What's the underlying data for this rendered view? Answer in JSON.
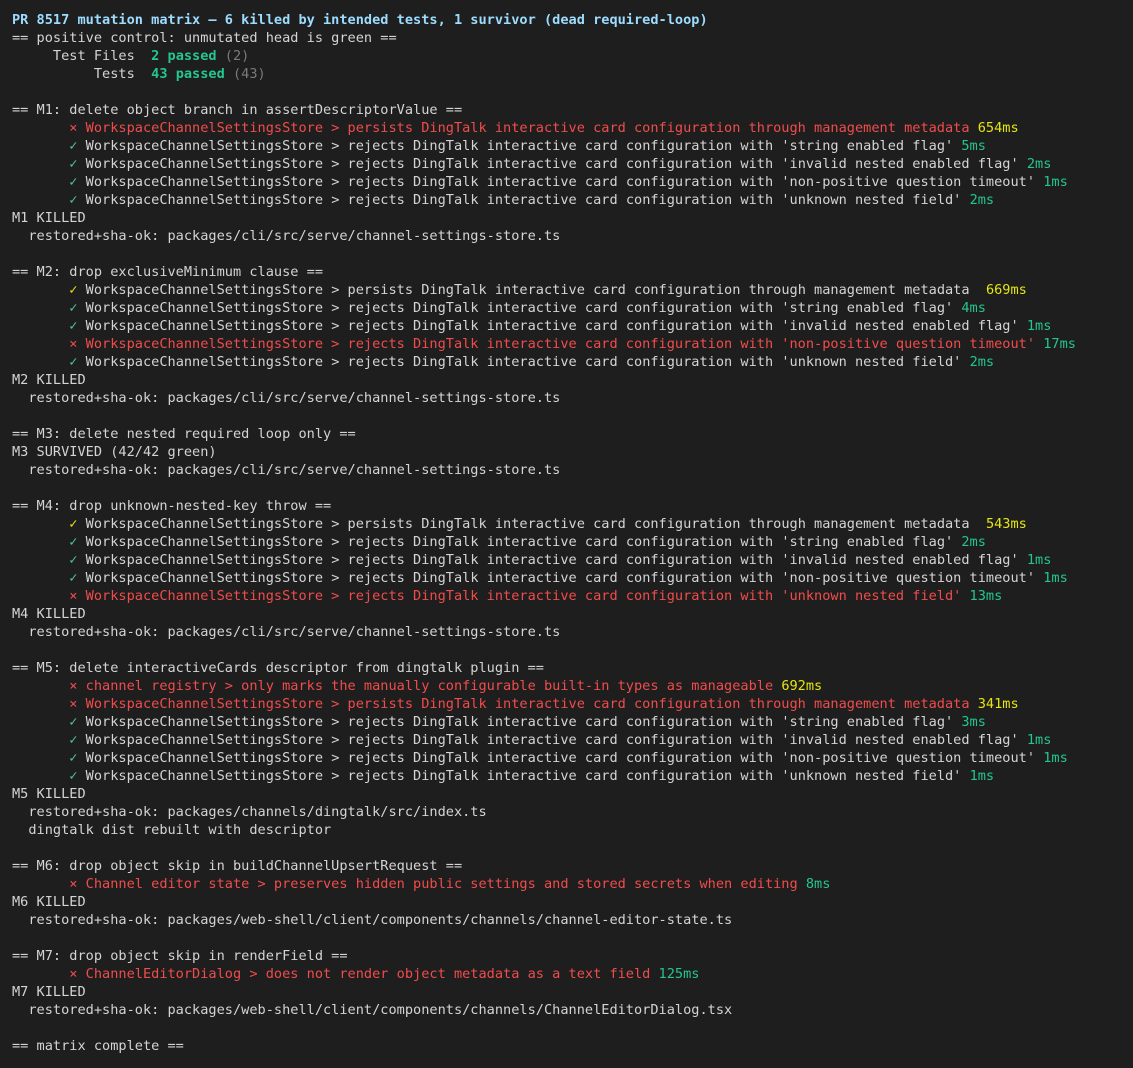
{
  "colors": {
    "background": "#1e1e1e",
    "text": "#d4d4d4",
    "header": "#9cdcfe",
    "pass_mark": "#4ec98f",
    "fail": "#f14c4c",
    "duration_slow": "#e5e510",
    "duration_fast": "#23c78e",
    "dim": "#7a7a7a"
  },
  "lines": [
    [
      {
        "t": "PR 8517 mutation matrix — 6 killed by intended tests, 1 survivor (dead required-loop)",
        "c": "header"
      }
    ],
    [
      {
        "t": "== positive control: unmutated head is green ==",
        "c": "plain"
      }
    ],
    [
      {
        "t": "     Test Files  ",
        "c": "plain"
      },
      {
        "t": "2 passed",
        "c": "bold-pass"
      },
      {
        "t": " (2)",
        "c": "dim"
      }
    ],
    [
      {
        "t": "          Tests  ",
        "c": "plain"
      },
      {
        "t": "43 passed",
        "c": "bold-pass"
      },
      {
        "t": " (43)",
        "c": "dim"
      }
    ],
    [],
    [
      {
        "t": "== M1: delete object branch in assertDescriptorValue ==",
        "c": "plain"
      }
    ],
    [
      {
        "t": "       × WorkspaceChannelSettingsStore > persists DingTalk interactive card configuration through management metadata ",
        "c": "fail"
      },
      {
        "t": "654ms",
        "c": "dur-slow"
      }
    ],
    [
      {
        "t": "       ✓",
        "c": "pass"
      },
      {
        "t": " WorkspaceChannelSettingsStore > rejects DingTalk interactive card configuration with 'string enabled flag' ",
        "c": "plain"
      },
      {
        "t": "5ms",
        "c": "dur-fast"
      }
    ],
    [
      {
        "t": "       ✓",
        "c": "pass"
      },
      {
        "t": " WorkspaceChannelSettingsStore > rejects DingTalk interactive card configuration with 'invalid nested enabled flag' ",
        "c": "plain"
      },
      {
        "t": "2ms",
        "c": "dur-fast"
      }
    ],
    [
      {
        "t": "       ✓",
        "c": "pass"
      },
      {
        "t": " WorkspaceChannelSettingsStore > rejects DingTalk interactive card configuration with 'non-positive question timeout' ",
        "c": "plain"
      },
      {
        "t": "1ms",
        "c": "dur-fast"
      }
    ],
    [
      {
        "t": "       ✓",
        "c": "pass"
      },
      {
        "t": " WorkspaceChannelSettingsStore > rejects DingTalk interactive card configuration with 'unknown nested field' ",
        "c": "plain"
      },
      {
        "t": "2ms",
        "c": "dur-fast"
      }
    ],
    [
      {
        "t": "M1 KILLED",
        "c": "plain"
      }
    ],
    [
      {
        "t": "  restored+sha-ok: packages/cli/src/serve/channel-settings-store.ts",
        "c": "plain"
      }
    ],
    [],
    [
      {
        "t": "== M2: drop exclusiveMinimum clause ==",
        "c": "plain"
      }
    ],
    [
      {
        "t": "       ✓",
        "c": "dur-slow"
      },
      {
        "t": " WorkspaceChannelSettingsStore > persists DingTalk interactive card configuration through management metadata  ",
        "c": "plain"
      },
      {
        "t": "669ms",
        "c": "dur-slow"
      }
    ],
    [
      {
        "t": "       ✓",
        "c": "pass"
      },
      {
        "t": " WorkspaceChannelSettingsStore > rejects DingTalk interactive card configuration with 'string enabled flag' ",
        "c": "plain"
      },
      {
        "t": "4ms",
        "c": "dur-fast"
      }
    ],
    [
      {
        "t": "       ✓",
        "c": "pass"
      },
      {
        "t": " WorkspaceChannelSettingsStore > rejects DingTalk interactive card configuration with 'invalid nested enabled flag' ",
        "c": "plain"
      },
      {
        "t": "1ms",
        "c": "dur-fast"
      }
    ],
    [
      {
        "t": "       × WorkspaceChannelSettingsStore > rejects DingTalk interactive card configuration with 'non-positive question timeout' ",
        "c": "fail"
      },
      {
        "t": "17ms",
        "c": "dur-fast"
      }
    ],
    [
      {
        "t": "       ✓",
        "c": "pass"
      },
      {
        "t": " WorkspaceChannelSettingsStore > rejects DingTalk interactive card configuration with 'unknown nested field' ",
        "c": "plain"
      },
      {
        "t": "2ms",
        "c": "dur-fast"
      }
    ],
    [
      {
        "t": "M2 KILLED",
        "c": "plain"
      }
    ],
    [
      {
        "t": "  restored+sha-ok: packages/cli/src/serve/channel-settings-store.ts",
        "c": "plain"
      }
    ],
    [],
    [
      {
        "t": "== M3: delete nested required loop only ==",
        "c": "plain"
      }
    ],
    [
      {
        "t": "M3 SURVIVED (42/42 green)",
        "c": "plain"
      }
    ],
    [
      {
        "t": "  restored+sha-ok: packages/cli/src/serve/channel-settings-store.ts",
        "c": "plain"
      }
    ],
    [],
    [
      {
        "t": "== M4: drop unknown-nested-key throw ==",
        "c": "plain"
      }
    ],
    [
      {
        "t": "       ✓",
        "c": "dur-slow"
      },
      {
        "t": " WorkspaceChannelSettingsStore > persists DingTalk interactive card configuration through management metadata  ",
        "c": "plain"
      },
      {
        "t": "543ms",
        "c": "dur-slow"
      }
    ],
    [
      {
        "t": "       ✓",
        "c": "pass"
      },
      {
        "t": " WorkspaceChannelSettingsStore > rejects DingTalk interactive card configuration with 'string enabled flag' ",
        "c": "plain"
      },
      {
        "t": "2ms",
        "c": "dur-fast"
      }
    ],
    [
      {
        "t": "       ✓",
        "c": "pass"
      },
      {
        "t": " WorkspaceChannelSettingsStore > rejects DingTalk interactive card configuration with 'invalid nested enabled flag' ",
        "c": "plain"
      },
      {
        "t": "1ms",
        "c": "dur-fast"
      }
    ],
    [
      {
        "t": "       ✓",
        "c": "pass"
      },
      {
        "t": " WorkspaceChannelSettingsStore > rejects DingTalk interactive card configuration with 'non-positive question timeout' ",
        "c": "plain"
      },
      {
        "t": "1ms",
        "c": "dur-fast"
      }
    ],
    [
      {
        "t": "       × WorkspaceChannelSettingsStore > rejects DingTalk interactive card configuration with 'unknown nested field' ",
        "c": "fail"
      },
      {
        "t": "13ms",
        "c": "dur-fast"
      }
    ],
    [
      {
        "t": "M4 KILLED",
        "c": "plain"
      }
    ],
    [
      {
        "t": "  restored+sha-ok: packages/cli/src/serve/channel-settings-store.ts",
        "c": "plain"
      }
    ],
    [],
    [
      {
        "t": "== M5: delete interactiveCards descriptor from dingtalk plugin ==",
        "c": "plain"
      }
    ],
    [
      {
        "t": "       × channel registry > only marks the manually configurable built-in types as manageable ",
        "c": "fail"
      },
      {
        "t": "692ms",
        "c": "dur-slow"
      }
    ],
    [
      {
        "t": "       × WorkspaceChannelSettingsStore > persists DingTalk interactive card configuration through management metadata ",
        "c": "fail"
      },
      {
        "t": "341ms",
        "c": "dur-slow"
      }
    ],
    [
      {
        "t": "       ✓",
        "c": "pass"
      },
      {
        "t": " WorkspaceChannelSettingsStore > rejects DingTalk interactive card configuration with 'string enabled flag' ",
        "c": "plain"
      },
      {
        "t": "3ms",
        "c": "dur-fast"
      }
    ],
    [
      {
        "t": "       ✓",
        "c": "pass"
      },
      {
        "t": " WorkspaceChannelSettingsStore > rejects DingTalk interactive card configuration with 'invalid nested enabled flag' ",
        "c": "plain"
      },
      {
        "t": "1ms",
        "c": "dur-fast"
      }
    ],
    [
      {
        "t": "       ✓",
        "c": "pass"
      },
      {
        "t": " WorkspaceChannelSettingsStore > rejects DingTalk interactive card configuration with 'non-positive question timeout' ",
        "c": "plain"
      },
      {
        "t": "1ms",
        "c": "dur-fast"
      }
    ],
    [
      {
        "t": "       ✓",
        "c": "pass"
      },
      {
        "t": " WorkspaceChannelSettingsStore > rejects DingTalk interactive card configuration with 'unknown nested field' ",
        "c": "plain"
      },
      {
        "t": "1ms",
        "c": "dur-fast"
      }
    ],
    [
      {
        "t": "M5 KILLED",
        "c": "plain"
      }
    ],
    [
      {
        "t": "  restored+sha-ok: packages/channels/dingtalk/src/index.ts",
        "c": "plain"
      }
    ],
    [
      {
        "t": "  dingtalk dist rebuilt with descriptor",
        "c": "plain"
      }
    ],
    [],
    [
      {
        "t": "== M6: drop object skip in buildChannelUpsertRequest ==",
        "c": "plain"
      }
    ],
    [
      {
        "t": "       × Channel editor state > preserves hidden public settings and stored secrets when editing ",
        "c": "fail"
      },
      {
        "t": "8ms",
        "c": "dur-fast"
      }
    ],
    [
      {
        "t": "M6 KILLED",
        "c": "plain"
      }
    ],
    [
      {
        "t": "  restored+sha-ok: packages/web-shell/client/components/channels/channel-editor-state.ts",
        "c": "plain"
      }
    ],
    [],
    [
      {
        "t": "== M7: drop object skip in renderField ==",
        "c": "plain"
      }
    ],
    [
      {
        "t": "       × ChannelEditorDialog > does not render object metadata as a text field ",
        "c": "fail"
      },
      {
        "t": "125ms",
        "c": "dur-fast"
      }
    ],
    [
      {
        "t": "M7 KILLED",
        "c": "plain"
      }
    ],
    [
      {
        "t": "  restored+sha-ok: packages/web-shell/client/components/channels/ChannelEditorDialog.tsx",
        "c": "plain"
      }
    ],
    [],
    [
      {
        "t": "== matrix complete ==",
        "c": "plain"
      }
    ]
  ]
}
